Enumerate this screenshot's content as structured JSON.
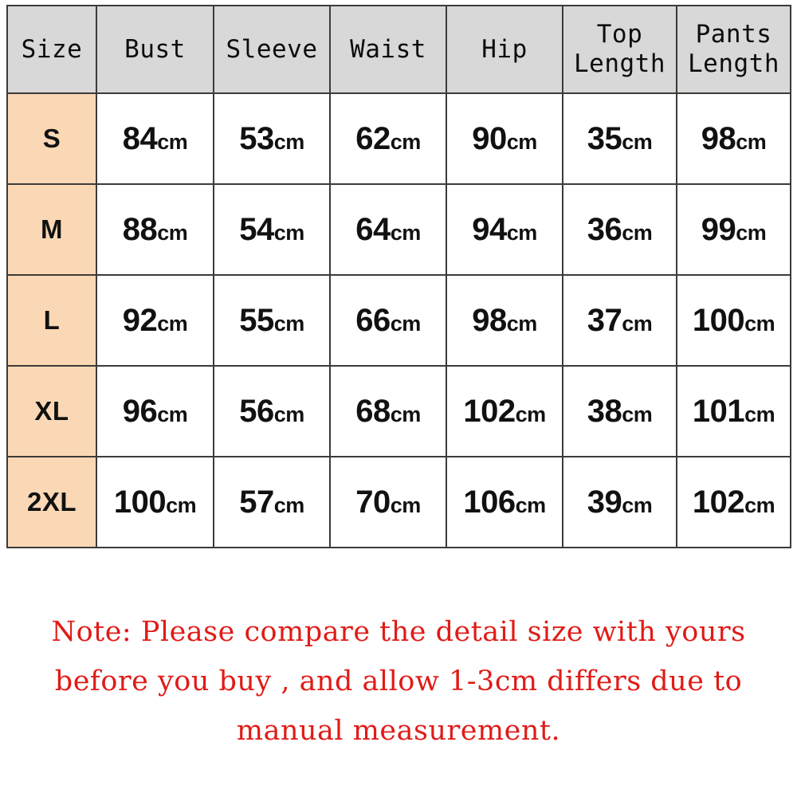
{
  "table": {
    "columns": [
      {
        "key": "size",
        "label": "Size"
      },
      {
        "key": "bust",
        "label": "Bust"
      },
      {
        "key": "sleeve",
        "label": "Sleeve"
      },
      {
        "key": "waist",
        "label": "Waist"
      },
      {
        "key": "hip",
        "label": "Hip"
      },
      {
        "key": "top_length",
        "label": "Top\nLength"
      },
      {
        "key": "pants_length",
        "label": "Pants\nLength"
      }
    ],
    "rows": [
      {
        "size": "S",
        "bust": "84cm",
        "sleeve": "53cm",
        "waist": "62cm",
        "hip": "90cm",
        "top_length": "35cm",
        "pants_length": "98cm"
      },
      {
        "size": "M",
        "bust": "88cm",
        "sleeve": "54cm",
        "waist": "64cm",
        "hip": "94cm",
        "top_length": "36cm",
        "pants_length": "99cm"
      },
      {
        "size": "L",
        "bust": "92cm",
        "sleeve": "55cm",
        "waist": "66cm",
        "hip": "98cm",
        "top_length": "37cm",
        "pants_length": "100cm"
      },
      {
        "size": "XL",
        "bust": "96cm",
        "sleeve": "56cm",
        "waist": "68cm",
        "hip": "102cm",
        "top_length": "38cm",
        "pants_length": "101cm"
      },
      {
        "size": "2XL",
        "bust": "100cm",
        "sleeve": "57cm",
        "waist": "70cm",
        "hip": "106cm",
        "top_length": "39cm",
        "pants_length": "102cm"
      }
    ],
    "unit_suffix": "cm"
  },
  "note": {
    "lines": [
      "Note: Please compare the detail size with yours",
      "before you buy , and allow 1-3cm differs due to",
      "manual measurement."
    ]
  },
  "colors": {
    "header_fill": "#d8d8d8",
    "size_cell_fill": "#fbd8b5",
    "cell_fill": "#ffffff",
    "border": "#3d3b38",
    "text": "#111111",
    "note_text": "#e01b17"
  }
}
